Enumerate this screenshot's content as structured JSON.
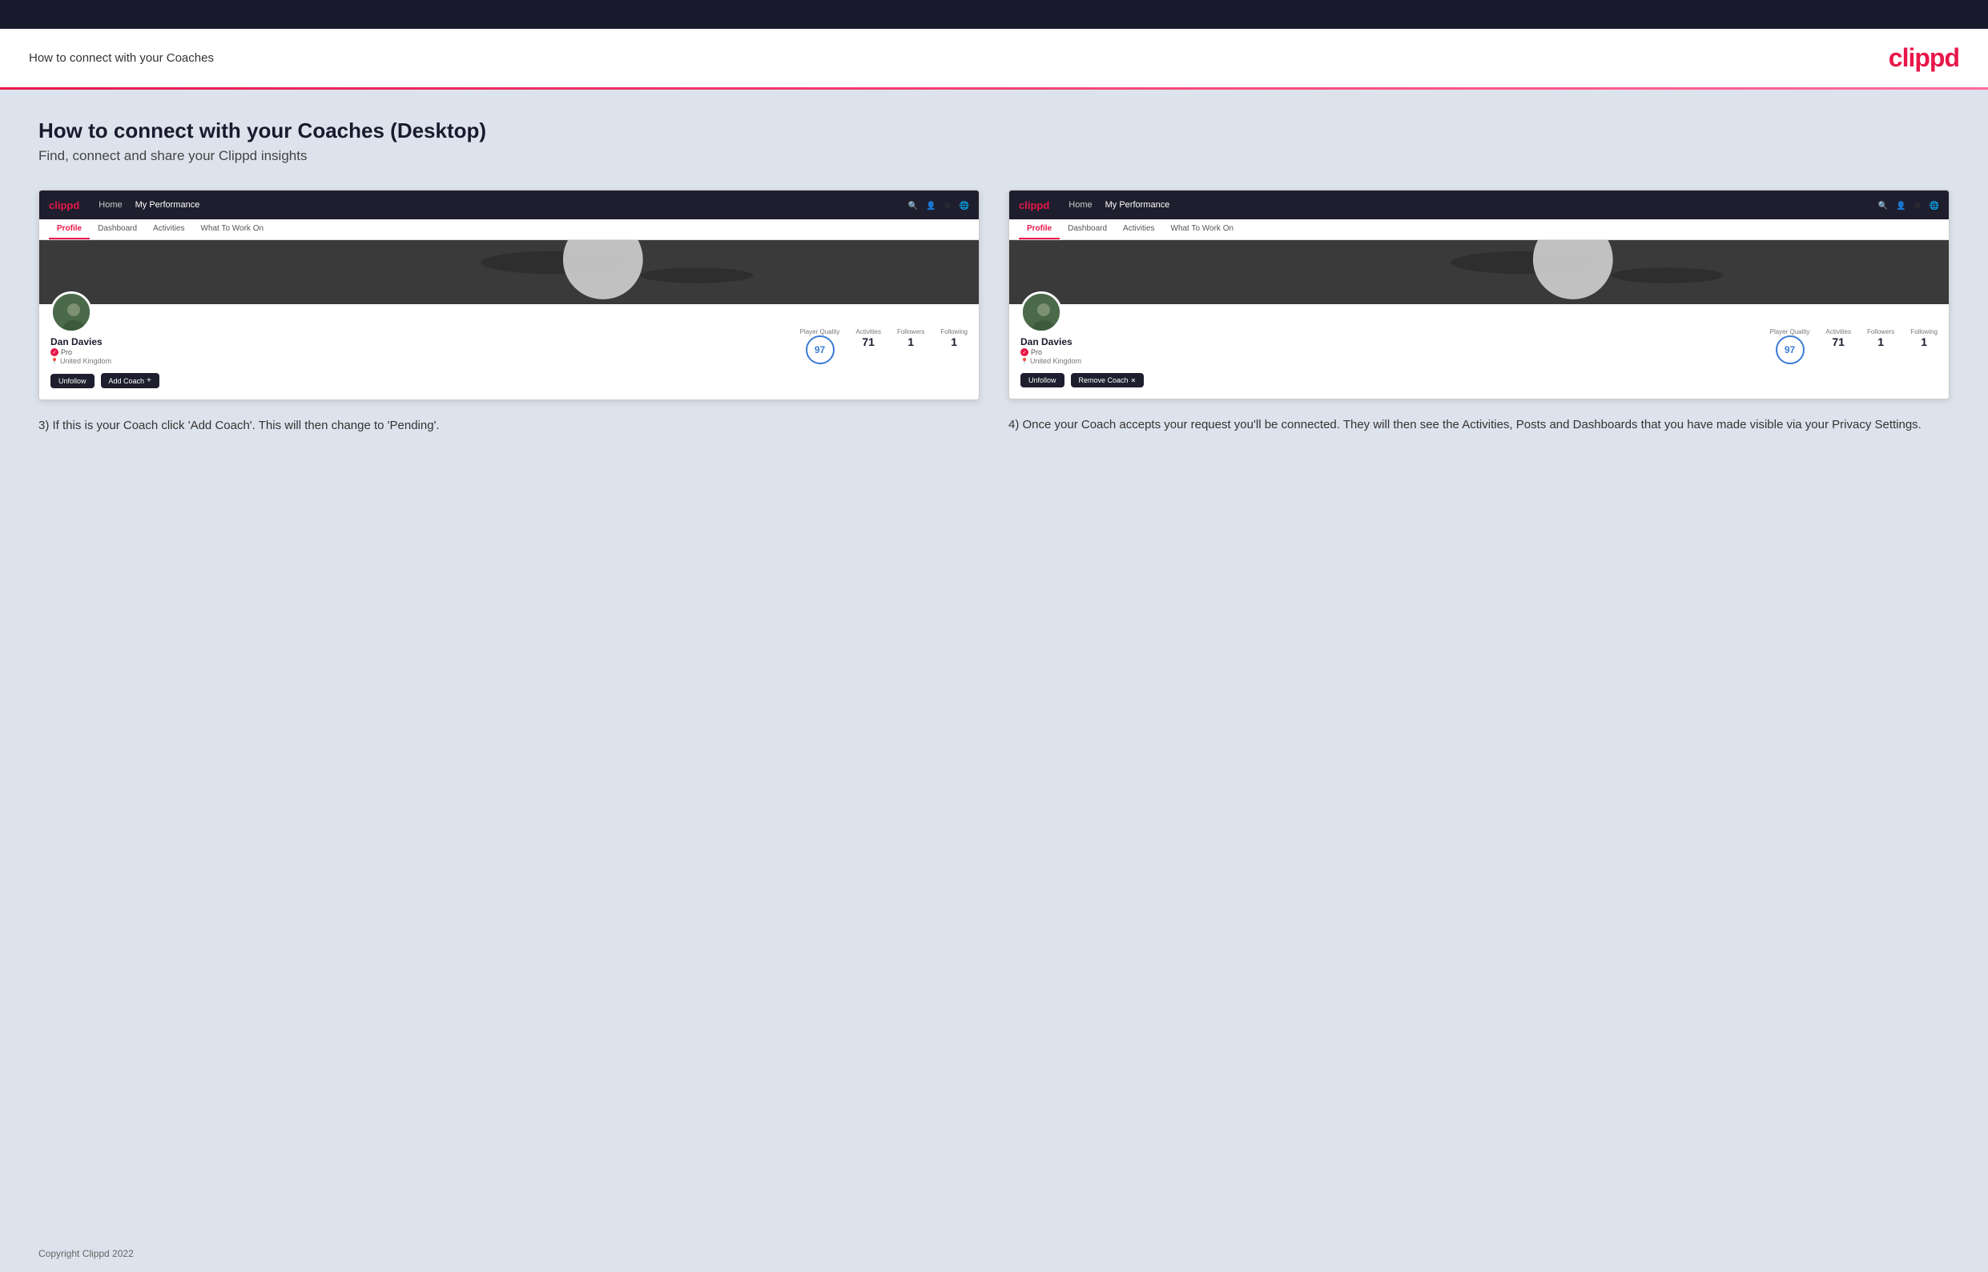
{
  "topbar": {},
  "header": {
    "title": "How to connect with your Coaches",
    "logo": "clippd"
  },
  "page": {
    "heading": "How to connect with your Coaches (Desktop)",
    "subheading": "Find, connect and share your Clippd insights"
  },
  "screenshot_left": {
    "navbar": {
      "logo": "clippd",
      "links": [
        "Home",
        "My Performance"
      ]
    },
    "tabs": [
      "Profile",
      "Dashboard",
      "Activities",
      "What To Work On"
    ],
    "active_tab": "Profile",
    "profile": {
      "name": "Dan Davies",
      "badge": "Pro",
      "location": "United Kingdom",
      "player_quality_label": "Player Quality",
      "player_quality_value": "97",
      "stats": [
        {
          "label": "Activities",
          "value": "71"
        },
        {
          "label": "Followers",
          "value": "1"
        },
        {
          "label": "Following",
          "value": "1"
        }
      ],
      "buttons": [
        "Unfollow",
        "Add Coach"
      ]
    }
  },
  "screenshot_right": {
    "navbar": {
      "logo": "clippd",
      "links": [
        "Home",
        "My Performance"
      ]
    },
    "tabs": [
      "Profile",
      "Dashboard",
      "Activities",
      "What To Work On"
    ],
    "active_tab": "Profile",
    "profile": {
      "name": "Dan Davies",
      "badge": "Pro",
      "location": "United Kingdom",
      "player_quality_label": "Player Quality",
      "player_quality_value": "97",
      "stats": [
        {
          "label": "Activities",
          "value": "71"
        },
        {
          "label": "Followers",
          "value": "1"
        },
        {
          "label": "Following",
          "value": "1"
        }
      ],
      "buttons": [
        "Unfollow",
        "Remove Coach"
      ]
    }
  },
  "caption_left": "3) If this is your Coach click 'Add Coach'. This will then change to 'Pending'.",
  "caption_right": "4) Once your Coach accepts your request you'll be connected. They will then see the Activities, Posts and Dashboards that you have made visible via your Privacy Settings.",
  "footer": "Copyright Clippd 2022"
}
